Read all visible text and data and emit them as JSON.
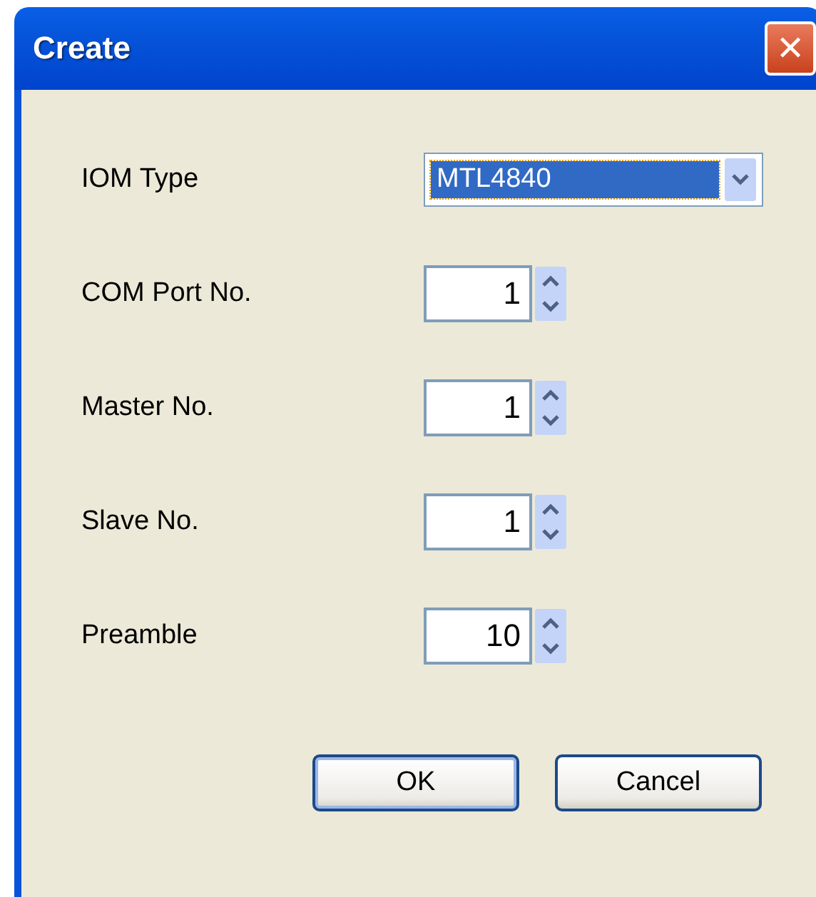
{
  "window": {
    "title": "Create",
    "close": "✕"
  },
  "fields": [
    {
      "kind": "dropdown",
      "label": "IOM Type",
      "value": "MTL4840"
    },
    {
      "kind": "spinner",
      "label": "COM Port No.",
      "value": "1"
    },
    {
      "kind": "spinner",
      "label": "Master No.",
      "value": "1"
    },
    {
      "kind": "spinner",
      "label": "Slave No.",
      "value": "1"
    },
    {
      "kind": "spinner",
      "label": "Preamble",
      "value": "10"
    }
  ],
  "buttons": [
    {
      "label": "OK",
      "default": true
    },
    {
      "label": "Cancel",
      "default": false
    }
  ]
}
